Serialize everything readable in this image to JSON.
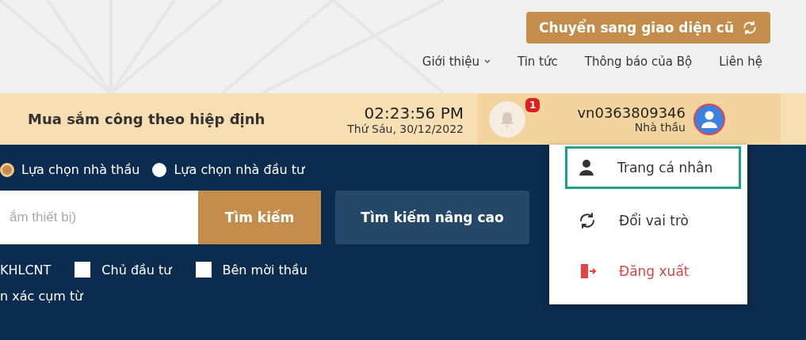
{
  "top_button": {
    "label": "Chuyển sang giao diện cũ"
  },
  "nav": [
    {
      "label": "Giới thiệu",
      "has_dropdown": true
    },
    {
      "label": "Tin tức",
      "has_dropdown": false
    },
    {
      "label": "Thông báo của Bộ",
      "has_dropdown": false
    },
    {
      "label": "Liên hệ",
      "has_dropdown": false
    }
  ],
  "header": {
    "title": "Mua sắm công theo hiệp định",
    "time": "02:23:56 PM",
    "date": "Thứ Sáu, 30/12/2022",
    "notification_count": "1",
    "username": "vn0363809346",
    "role": "Nhà thầu"
  },
  "mode_options": [
    {
      "label": "Lựa chọn nhà thầu",
      "selected": true
    },
    {
      "label": "Lựa chọn nhà đầu tư",
      "selected": false
    }
  ],
  "search": {
    "placeholder": "ắm thiết bị)",
    "button": "Tìm kiếm",
    "advanced_button": "Tìm kiếm nâng cao"
  },
  "filter_partial_label": "KHLCNT",
  "filters": [
    {
      "label": "Chủ đầu tư",
      "checked": false
    },
    {
      "label": "Bên mời thầu",
      "checked": false
    }
  ],
  "exact_phrase_partial": "n xác cụm từ",
  "user_menu": [
    {
      "kind": "profile",
      "label": "Trang cá nhân",
      "selected": true
    },
    {
      "kind": "switch",
      "label": "Đổi vai trò",
      "selected": false
    },
    {
      "kind": "logout",
      "label": "Đăng xuất",
      "selected": false
    }
  ]
}
